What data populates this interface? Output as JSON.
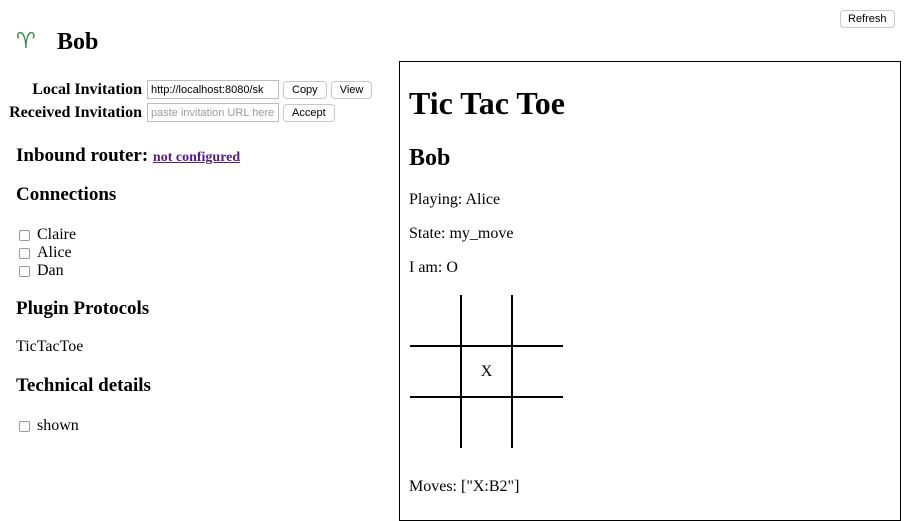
{
  "toolbar": {
    "refresh_label": "Refresh"
  },
  "header": {
    "icon": "aries-icon",
    "icon_glyph": "♈",
    "title": "Bob",
    "icon_color": "#3f8a4e"
  },
  "invitation": {
    "local_label": "Local Invitation",
    "local_value": "http://localhost:8080/sk",
    "copy_label": "Copy",
    "view_label": "View",
    "received_label": "Received Invitation",
    "received_value": "",
    "received_placeholder": "paste invitation URL here",
    "accept_label": "Accept"
  },
  "inbound_router": {
    "label": "Inbound router:",
    "value": "not configured",
    "link_color": "#551a8b"
  },
  "connections": {
    "heading": "Connections",
    "items": [
      {
        "name": "Claire",
        "checked": false
      },
      {
        "name": "Alice",
        "checked": false
      },
      {
        "name": "Dan",
        "checked": false
      }
    ]
  },
  "plugins": {
    "heading": "Plugin Protocols",
    "items": [
      "TicTacToe"
    ]
  },
  "technical": {
    "heading": "Technical details",
    "toggle_label": "shown",
    "checked": false
  },
  "game": {
    "title": "Tic Tac Toe",
    "player": "Bob",
    "playing": "Playing: Alice",
    "state": "State: my_move",
    "i_am": "I am: O",
    "board": [
      [
        "",
        "",
        ""
      ],
      [
        "",
        "X",
        ""
      ],
      [
        "",
        "",
        ""
      ]
    ],
    "moves": "Moves: [\"X:B2\"]"
  }
}
